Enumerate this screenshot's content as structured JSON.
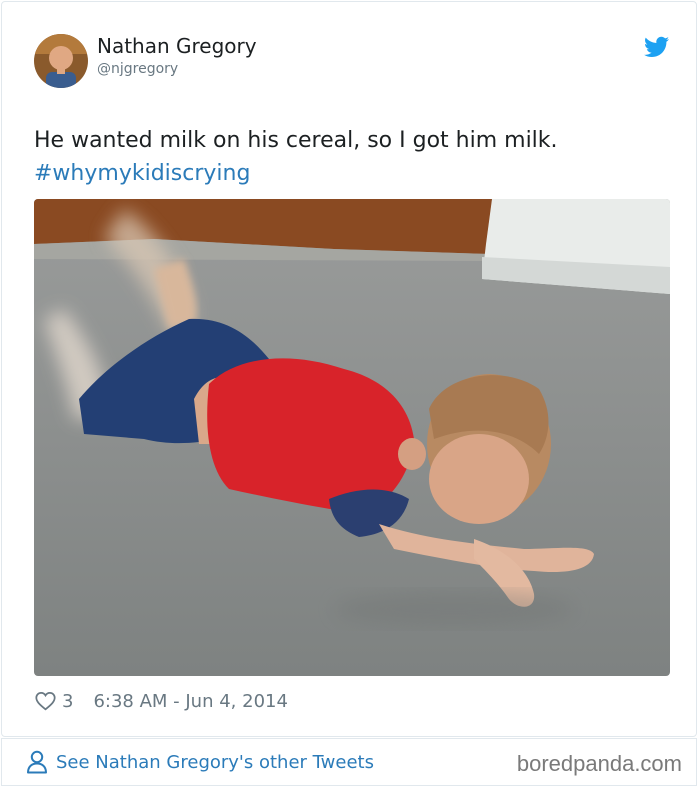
{
  "author": {
    "name": "Nathan Gregory",
    "handle": "@njgregory",
    "avatar_icon": "user-avatar"
  },
  "tweet": {
    "text": "He wanted milk on his cereal, so I got him milk.",
    "hashtag": "#whymykidiscrying"
  },
  "stats": {
    "likes": "3",
    "timestamp": "6:38 AM - Jun 4, 2014"
  },
  "footer": {
    "see_more": "See Nathan Gregory's other Tweets",
    "watermark": "boredpanda.com"
  },
  "colors": {
    "link": "#2b7bb9",
    "muted": "#697882",
    "twitter_blue": "#1da1f2"
  }
}
